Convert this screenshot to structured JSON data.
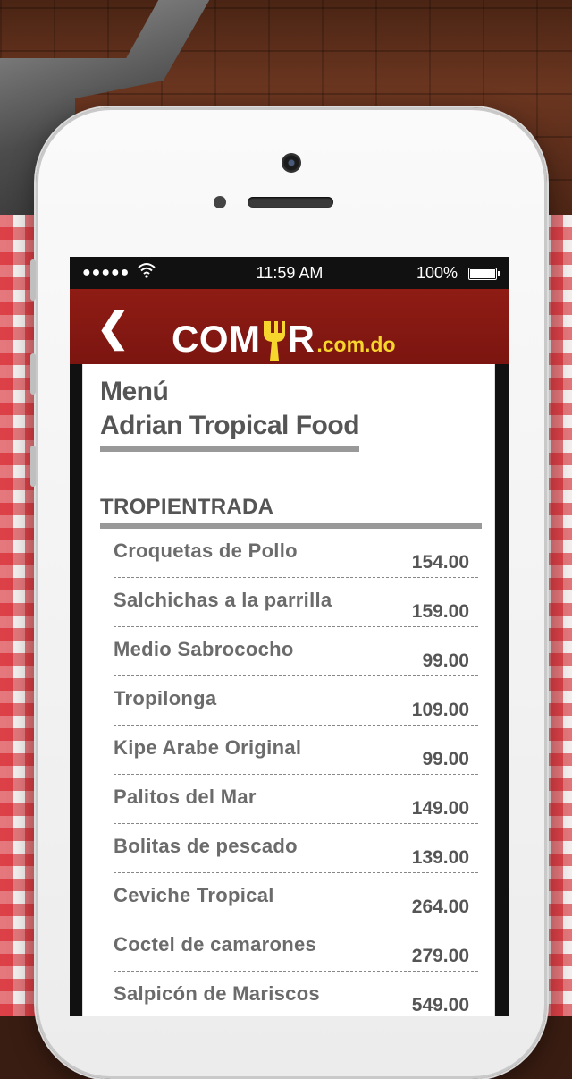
{
  "status_bar": {
    "signal": "●●●●●",
    "time": "11:59 AM",
    "battery": "100%"
  },
  "nav": {
    "back_glyph": "❮",
    "logo_left": "COM",
    "logo_right": "R",
    "logo_tld": ".com.do"
  },
  "menu": {
    "heading": "Menú",
    "restaurant": "Adrian Tropical Food",
    "section": "TROPIENTRADA",
    "items": [
      {
        "name": "Croquetas de Pollo",
        "price": "154.00"
      },
      {
        "name": "Salchichas a la parrilla",
        "price": "159.00"
      },
      {
        "name": "Medio Sabrococho",
        "price": "99.00"
      },
      {
        "name": "Tropilonga",
        "price": "109.00"
      },
      {
        "name": "Kipe Arabe Original",
        "price": "99.00"
      },
      {
        "name": "Palitos del Mar",
        "price": "149.00"
      },
      {
        "name": "Bolitas de pescado",
        "price": "139.00"
      },
      {
        "name": "Ceviche Tropical",
        "price": "264.00"
      },
      {
        "name": "Coctel de camarones",
        "price": "279.00"
      },
      {
        "name": "Salpicón de Mariscos",
        "price": "549.00"
      }
    ]
  },
  "colors": {
    "nav_red": "#8e1c14",
    "logo_yellow": "#f6d52c",
    "tablecloth_red": "#d6141c"
  }
}
